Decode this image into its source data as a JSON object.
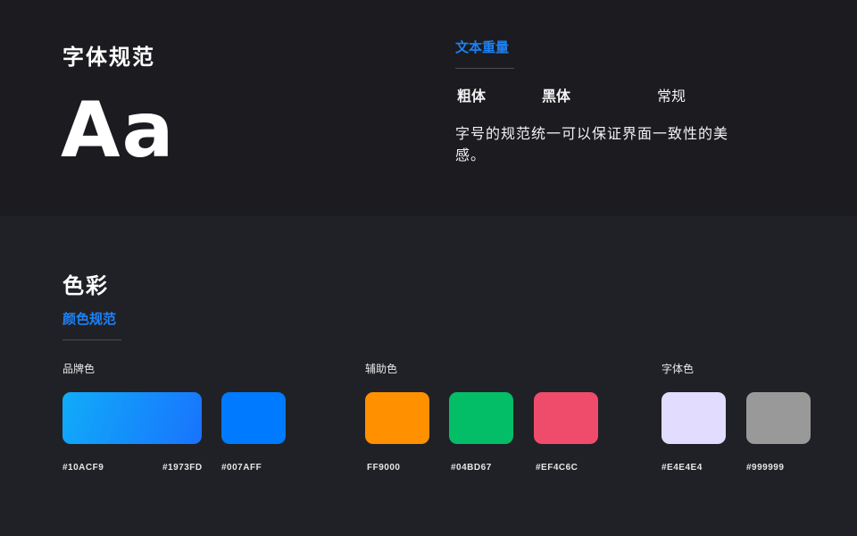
{
  "typography": {
    "title": "字体规范",
    "sample": "Aa",
    "weight_heading": "文本重量",
    "weights": [
      "粗体",
      "黑体",
      "常规"
    ],
    "description": "字号的规范统一可以保证界面一致性的美感。"
  },
  "color": {
    "title": "色彩",
    "subheading": "颜色规范",
    "groups": [
      {
        "label": "品牌色",
        "swatches": [
          {
            "name": "brand-gradient",
            "gradient": [
              "#10ACF9",
              "#1973FD"
            ],
            "hex_labels": [
              "#10ACF9",
              "#1973FD"
            ]
          },
          {
            "name": "brand-blue",
            "color": "#007AFF",
            "hex_label": "#007AFF"
          }
        ]
      },
      {
        "label": "辅助色",
        "swatches": [
          {
            "name": "orange",
            "color": "#FF9000",
            "hex_label": "FF9000"
          },
          {
            "name": "green",
            "color": "#04BD67",
            "hex_label": "#04BD67"
          },
          {
            "name": "red",
            "color": "#EF4C6C",
            "hex_label": "#EF4C6C"
          }
        ]
      },
      {
        "label": "字体色",
        "swatches": [
          {
            "name": "light",
            "color": "#E4E4E4",
            "display_color": "#E2DCFE",
            "hex_label": "#E4E4E4"
          },
          {
            "name": "gray",
            "color": "#999999",
            "hex_label": "#999999"
          }
        ]
      }
    ]
  },
  "colors": {
    "accent": "#1D82F5",
    "top_background": "#1B1B20",
    "bottom_background": "#202127"
  }
}
